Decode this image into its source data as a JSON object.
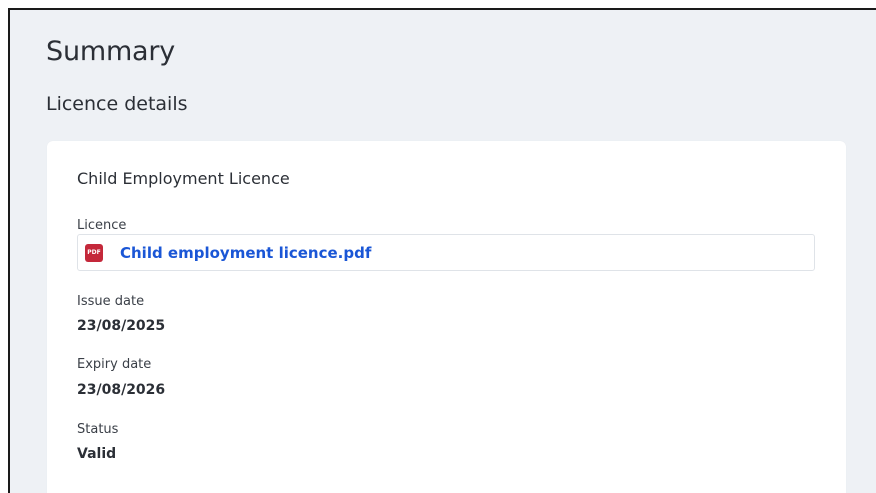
{
  "page": {
    "title": "Summary",
    "section_title": "Licence details"
  },
  "card": {
    "title": "Child Employment Licence",
    "licence": {
      "label": "Licence",
      "file_name": "Child employment licence.pdf",
      "file_icon": "pdf-icon",
      "file_icon_text": "PDF",
      "file_icon_color": "#c4283a",
      "link_color": "#1a56d6"
    },
    "issue_date": {
      "label": "Issue date",
      "value": "23/08/2025"
    },
    "expiry_date": {
      "label": "Expiry date",
      "value": "23/08/2026"
    },
    "status": {
      "label": "Status",
      "value": "Valid"
    }
  }
}
